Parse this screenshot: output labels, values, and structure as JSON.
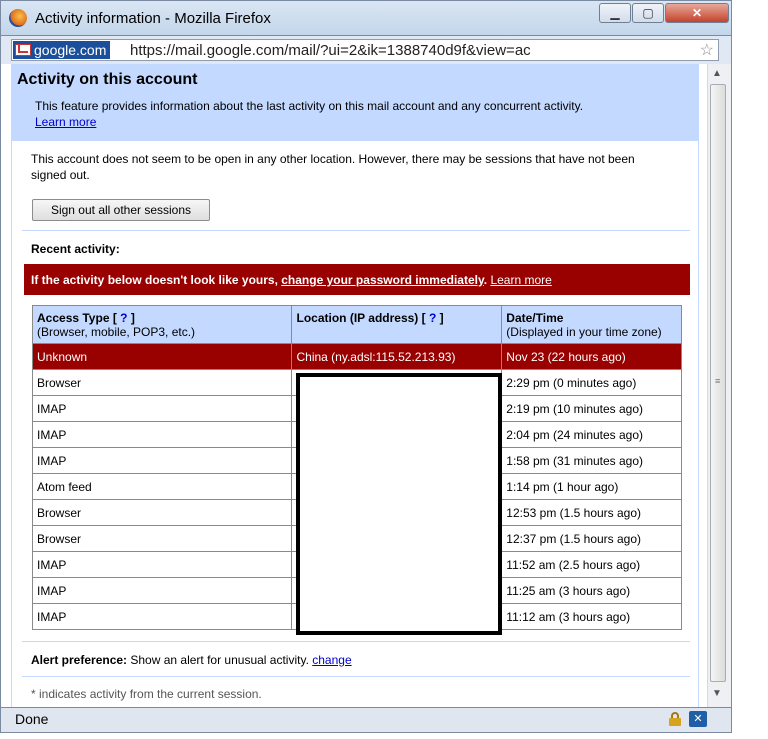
{
  "window": {
    "title": "Activity information - Mozilla Firefox",
    "minimize_label": "▁",
    "maximize_label": "▢",
    "close_label": "✕"
  },
  "address_bar": {
    "site_identity": "google.com",
    "url": "https://mail.google.com/mail/?ui=2&ik=1388740d9f&view=ac"
  },
  "header": {
    "title": "Activity on this account",
    "intro": "This feature provides information about the last activity on this mail account and any concurrent activity.",
    "learn_more": "Learn more"
  },
  "session_message": "This account does not seem to be open in any other location. However, there may be sessions that have not been signed out.",
  "signout_button": "Sign out all other sessions",
  "recent_activity_label": "Recent activity:",
  "warning": {
    "prefix": "If the activity below doesn't look like yours, ",
    "link": "change your password immediately",
    "separator": ". ",
    "learn_more": "Learn more"
  },
  "table": {
    "headers": [
      {
        "label": "Access Type",
        "help": "?",
        "sub": "(Browser, mobile, POP3, etc.)"
      },
      {
        "label": "Location (IP address)",
        "help": "?",
        "sub": ""
      },
      {
        "label": "Date/Time",
        "help": "",
        "sub": "(Displayed in your time zone)"
      }
    ],
    "rows": [
      {
        "type": "Unknown",
        "location": "China (ny.adsl:115.52.213.93)",
        "time": "Nov 23 (22 hours ago)"
      },
      {
        "type": "Browser",
        "location": "",
        "time": "2:29 pm (0 minutes ago)"
      },
      {
        "type": "IMAP",
        "location": "",
        "time": "2:19 pm (10 minutes ago)"
      },
      {
        "type": "IMAP",
        "location": "",
        "time": "2:04 pm (24 minutes ago)"
      },
      {
        "type": "IMAP",
        "location": "",
        "time": "1:58 pm (31 minutes ago)"
      },
      {
        "type": "Atom feed",
        "location": "",
        "time": "1:14 pm (1 hour ago)"
      },
      {
        "type": "Browser",
        "location": "",
        "time": "12:53 pm (1.5 hours ago)"
      },
      {
        "type": "Browser",
        "location": "",
        "time": "12:37 pm (1.5 hours ago)"
      },
      {
        "type": "IMAP",
        "location": "",
        "time": "11:52 am (2.5 hours ago)"
      },
      {
        "type": "IMAP",
        "location": "",
        "time": "11:25 am (3 hours ago)"
      },
      {
        "type": "IMAP",
        "location": "",
        "time": "11:12 am (3 hours ago)"
      }
    ]
  },
  "alert_preference": {
    "label": "Alert preference:",
    "text": " Show an alert for unusual activity. ",
    "link": "change"
  },
  "footnote": "* indicates activity from the current session.",
  "status": {
    "text": "Done"
  },
  "colors": {
    "header_bg": "#c3d9ff",
    "alert_red": "#990000",
    "link_blue": "#0000cc"
  }
}
